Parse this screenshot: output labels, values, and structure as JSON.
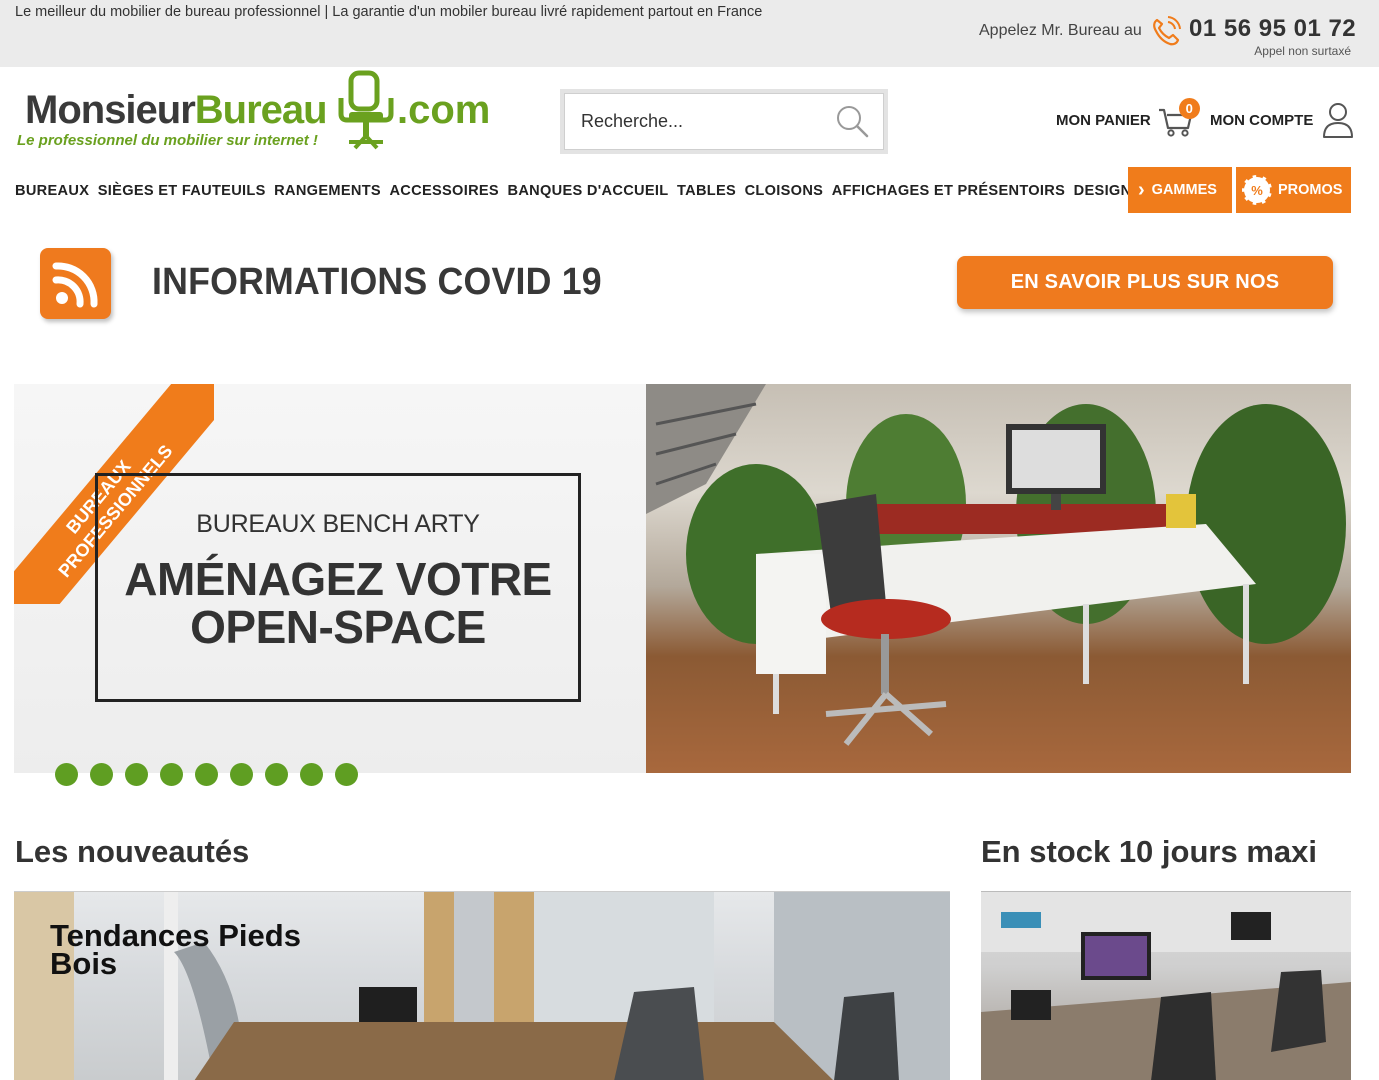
{
  "topbar": {
    "tagline": "Le meilleur du mobilier de bureau professionnel | La garantie d'un mobiler bureau livré rapidement partout en France",
    "call_label": "Appelez Mr. Bureau au",
    "phone": "01 56 95 01 72",
    "phone_note": "Appel non surtaxé"
  },
  "logo": {
    "part1": "Monsieur",
    "part2": "Bureau",
    "suffix": ".com",
    "slogan": "Le professionnel du mobilier sur internet !"
  },
  "search": {
    "placeholder": "Recherche..."
  },
  "header": {
    "cart_label": "MON PANIER",
    "cart_count": "0",
    "account_label": "MON COMPTE"
  },
  "nav": {
    "items": [
      "BUREAUX",
      "SIÈGES ET FAUTEUILS",
      "RANGEMENTS",
      "ACCESSOIRES",
      "BANQUES D'ACCUEIL",
      "TABLES",
      "CLOISONS",
      "AFFICHAGES ET PRÉSENTOIRS",
      "DESIGN"
    ],
    "gammes": "GAMMES",
    "promos": "PROMOS",
    "promos_icon_text": "%"
  },
  "covid": {
    "title": "INFORMATIONS COVID 19",
    "button": "EN SAVOIR PLUS SUR NOS SERVICES"
  },
  "hero": {
    "ribbon_line1": "BUREAUX",
    "ribbon_line2": "PROFESSIONNELS",
    "subtitle": "BUREAUX BENCH ARTY",
    "headline_line1": "AMÉNAGEZ VOTRE",
    "headline_line2": "OPEN-SPACE",
    "slide_count": 9
  },
  "sections": {
    "new_title": "Les nouveautés",
    "new_card_caption_line1": "Tendances Pieds",
    "new_card_caption_line2": "Bois",
    "stock_title": "En stock 10 jours maxi"
  },
  "colors": {
    "accent": "#f07c1b",
    "brand_green": "#6aa11f",
    "dot_green": "#5f9e22",
    "topbar_bg": "#ebebeb"
  }
}
